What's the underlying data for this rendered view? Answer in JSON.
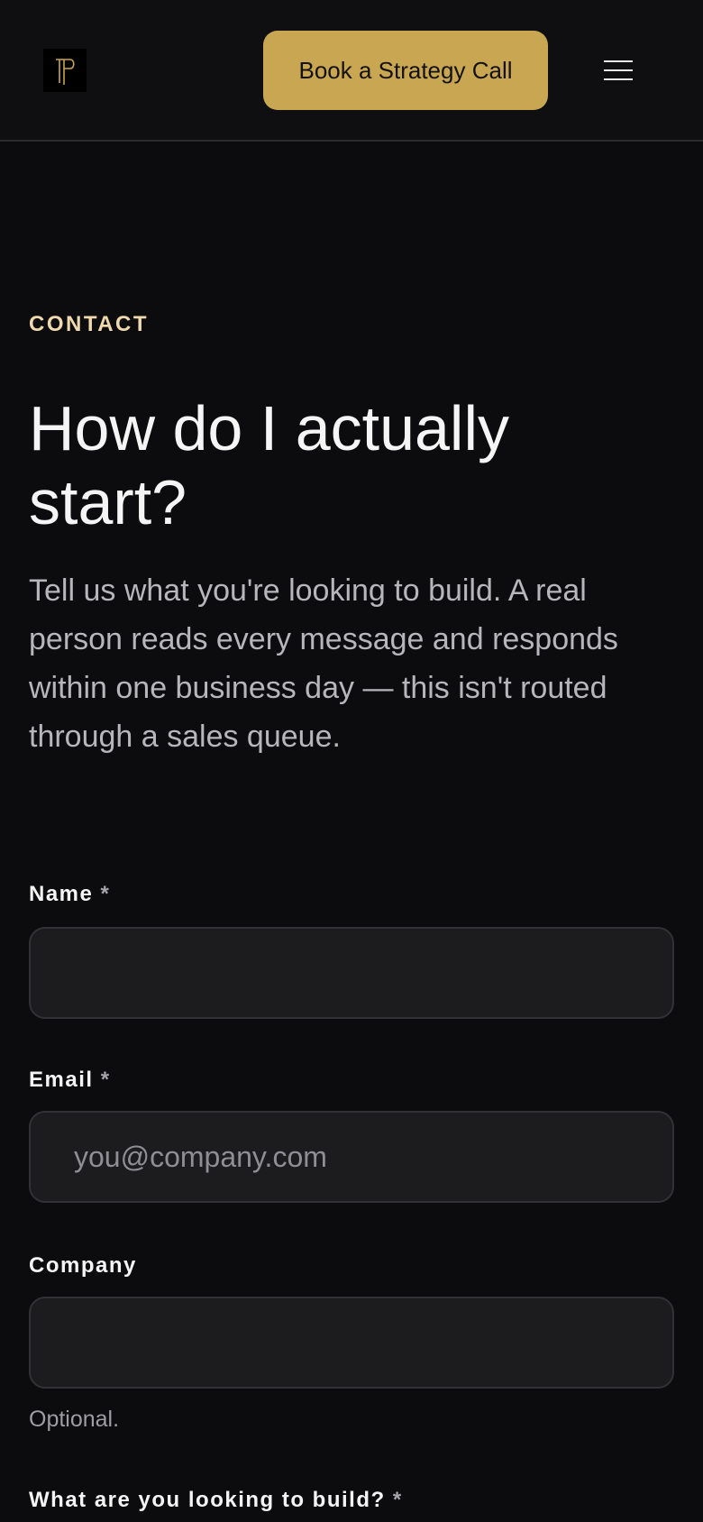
{
  "header": {
    "cta_label": "Book a Strategy Call",
    "icons": {
      "logo": "tp-monogram-logo",
      "menu": "hamburger-menu-icon"
    },
    "colors": {
      "accent": "#c9a651",
      "background": "#0f0f11"
    }
  },
  "section": {
    "eyebrow": "CONTACT",
    "title": "How do I actually start?",
    "intro": "Tell us what you're looking to build. A real person reads every message and responds within one business day — this isn't routed through a sales queue."
  },
  "form": {
    "name": {
      "label": "Name",
      "required": "*",
      "value": "",
      "placeholder": ""
    },
    "email": {
      "label": "Email",
      "required": "*",
      "value": "",
      "placeholder": "you@company.com"
    },
    "company": {
      "label": "Company",
      "value": "",
      "placeholder": "",
      "hint": "Optional."
    },
    "build": {
      "label": "What are you looking to build?",
      "required": "*"
    }
  }
}
